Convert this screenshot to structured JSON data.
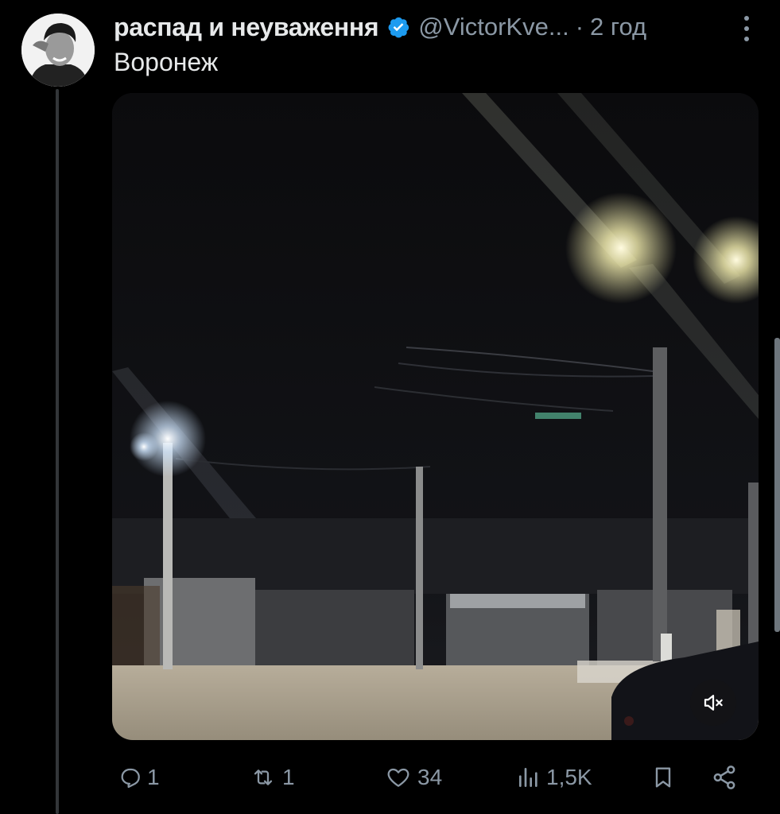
{
  "post": {
    "author_name": "распад и неуваження",
    "handle": "@VictorKve...",
    "separator": "·",
    "time": "2 год",
    "text": "Воронеж",
    "verified": true
  },
  "icons": {
    "verified": "verified-badge-icon",
    "more": "more-options-icon",
    "mute": "muted-speaker-icon",
    "reply": "reply-icon",
    "repost": "repost-icon",
    "like": "heart-icon",
    "views": "views-icon",
    "bookmark": "bookmark-icon",
    "share": "share-icon"
  },
  "actions": {
    "replies": "1",
    "reposts": "1",
    "likes": "34",
    "views": "1,5K"
  },
  "colors": {
    "background": "#000000",
    "text": "#e7e9ea",
    "secondary": "#8b98a5",
    "verified": "#1d9bf0"
  }
}
